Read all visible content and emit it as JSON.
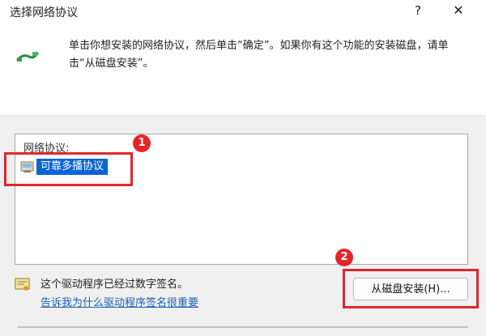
{
  "dialog": {
    "title": "选择网络协议",
    "help_label": "?",
    "close_label": "✕",
    "instruction": "单击你想安装的网络协议，然后单击“确定”。如果你有这个功能的安装磁盘，请单击“从磁盘安装”。",
    "list_header": "网络协议:",
    "protocols": [
      {
        "label": "可靠多播协议",
        "selected": true
      }
    ],
    "signature_text": "这个驱动程序已经过数字签名。",
    "signature_link": "告诉我为什么驱动程序签名很重要",
    "disk_button_label": "从磁盘安装(H)..."
  },
  "annotations": [
    {
      "number": "1",
      "color": "#e3262b"
    },
    {
      "number": "2",
      "color": "#e3262b"
    }
  ],
  "colors": {
    "selection": "#0a64d6",
    "link": "#1a5fb4",
    "annotation": "#e3262b",
    "panel_background": "#f0f0f0"
  },
  "icons": {
    "title_icon": "network-wire-icon",
    "row_icon": "protocol-icon",
    "signature_icon": "signature-certificate-icon"
  }
}
